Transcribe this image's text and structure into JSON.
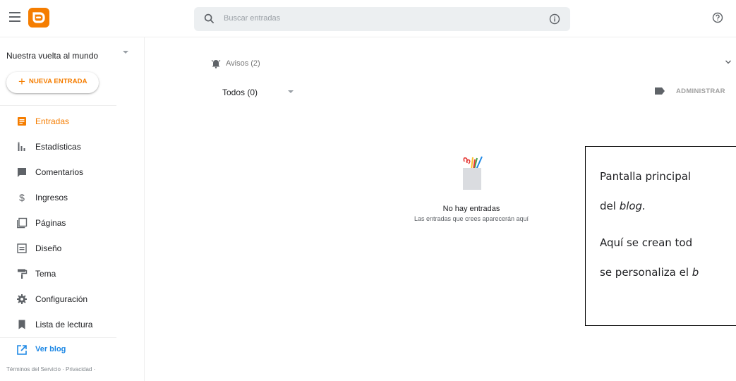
{
  "header": {
    "search_placeholder": "Buscar entradas",
    "brand_color": "#f57d00"
  },
  "sidebar": {
    "blog_name": "Nuestra vuelta al mundo",
    "new_post_label": "NUEVA ENTRADA",
    "items": [
      {
        "label": "Entradas",
        "icon": "posts-icon",
        "active": true
      },
      {
        "label": "Estadísticas",
        "icon": "stats-icon"
      },
      {
        "label": "Comentarios",
        "icon": "comments-icon"
      },
      {
        "label": "Ingresos",
        "icon": "dollar-icon"
      },
      {
        "label": "Páginas",
        "icon": "pages-icon"
      },
      {
        "label": "Diseño",
        "icon": "layout-icon"
      },
      {
        "label": "Tema",
        "icon": "paint-roller-icon"
      },
      {
        "label": "Configuración",
        "icon": "gear-icon"
      },
      {
        "label": "Lista de lectura",
        "icon": "bookmark-icon"
      }
    ],
    "view_blog_label": "Ver blog",
    "footer_links": "Términos del Servicio · Privacidad ·"
  },
  "main": {
    "notices_label": "Avisos (2)",
    "filter_label": "Todos (0)",
    "manage_label": "ADMINISTRAR",
    "empty_title": "No hay entradas",
    "empty_subtitle": "Las entradas que crees aparecerán aquí"
  },
  "callout": {
    "line1": "Pantalla principal",
    "line2_prefix": "del ",
    "line2_em": "blog.",
    "line3": "Aquí se crean tod",
    "line4_prefix": "se personaliza el ",
    "line4_em": "b"
  }
}
